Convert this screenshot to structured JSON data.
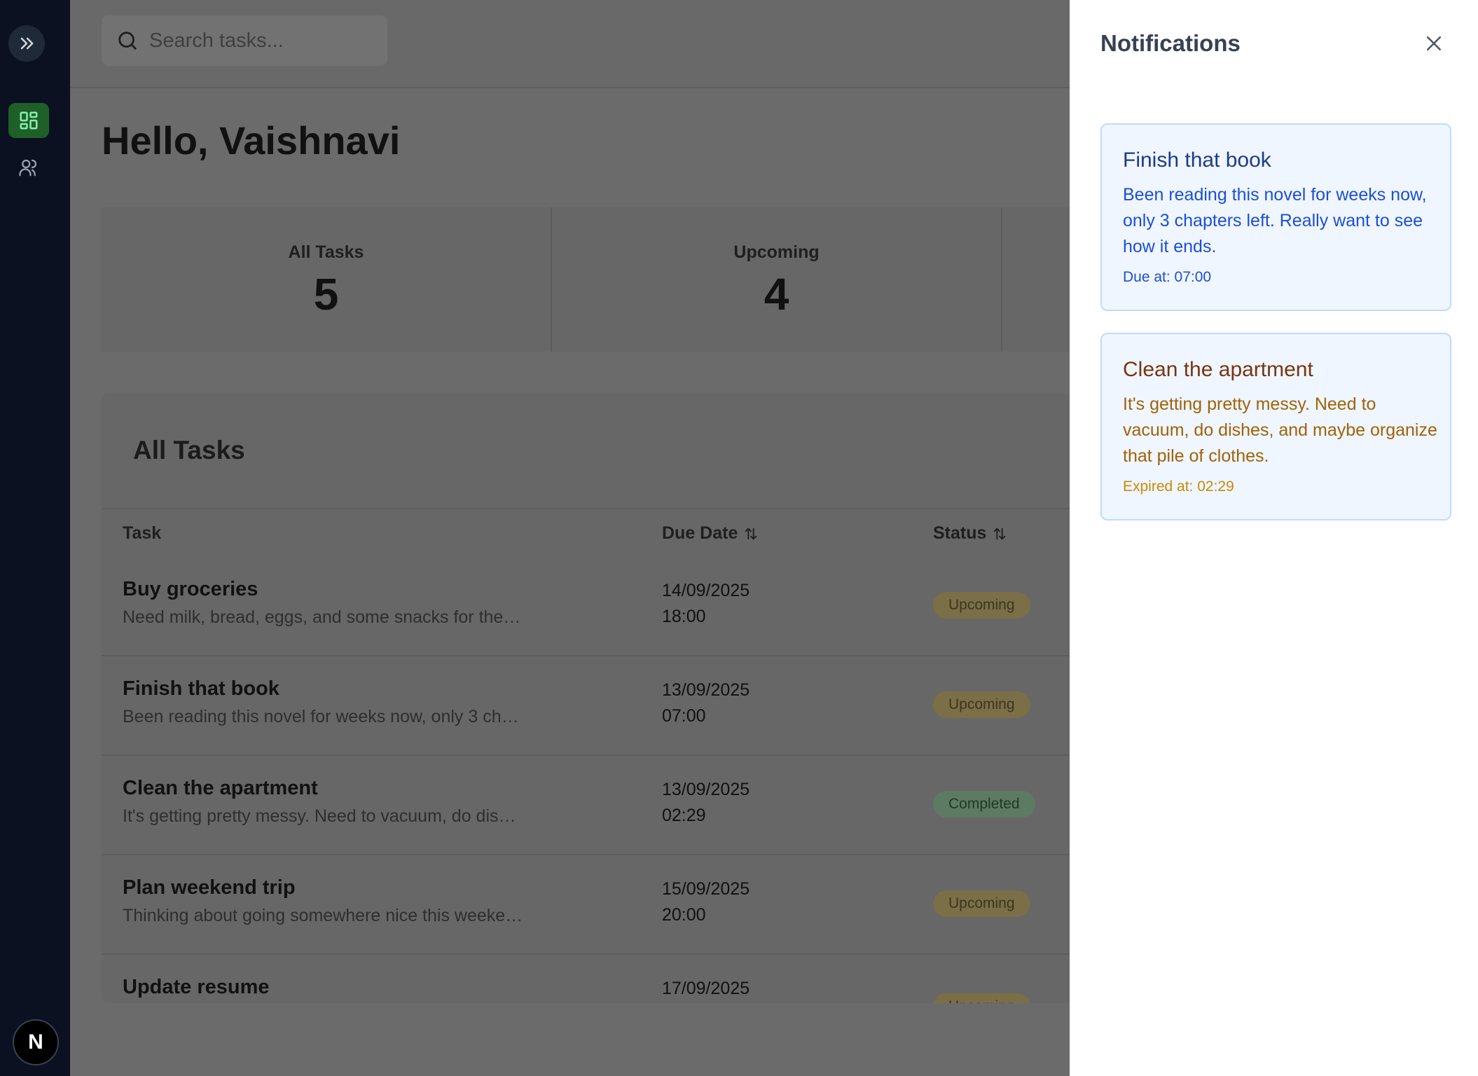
{
  "sidebar": {
    "toggle_icon": "chevrons-right-icon",
    "items": [
      {
        "name": "dashboard",
        "icon": "layout-grid-icon",
        "active": true
      },
      {
        "name": "users",
        "icon": "users-icon",
        "active": false
      }
    ],
    "avatar_initial": "N"
  },
  "search": {
    "placeholder": "Search tasks..."
  },
  "greeting": "Hello, Vaishnavi",
  "stats": [
    {
      "label": "All Tasks",
      "value": "5"
    },
    {
      "label": "Upcoming",
      "value": "4"
    }
  ],
  "tasks_panel": {
    "title": "All Tasks",
    "columns": {
      "task": "Task",
      "due": "Due Date",
      "status": "Status"
    },
    "rows": [
      {
        "title": "Buy groceries",
        "desc": "Need milk, bread, eggs, and some snacks for the…",
        "date": "14/09/2025",
        "time": "18:00",
        "status": "Upcoming"
      },
      {
        "title": "Finish that book",
        "desc": "Been reading this novel for weeks now, only 3 ch…",
        "date": "13/09/2025",
        "time": "07:00",
        "status": "Upcoming"
      },
      {
        "title": "Clean the apartment",
        "desc": "It's getting pretty messy. Need to vacuum, do dis…",
        "date": "13/09/2025",
        "time": "02:29",
        "status": "Completed"
      },
      {
        "title": "Plan weekend trip",
        "desc": "Thinking about going somewhere nice this weeke…",
        "date": "15/09/2025",
        "time": "20:00",
        "status": "Upcoming"
      },
      {
        "title": "Update resume",
        "desc": "",
        "date": "17/09/2025",
        "time": "",
        "status": "Upcoming"
      }
    ]
  },
  "notifications": {
    "title": "Notifications",
    "cards": [
      {
        "title": "Finish that book",
        "body": "Been reading this novel for weeks now, only 3 chapters left. Really want to see how it ends.",
        "footer": "Due at: 07:00",
        "tone": "blue"
      },
      {
        "title": "Clean the apartment",
        "body": "It's getting pretty messy. Need to vacuum, do dishes, and maybe organize that pile of clothes.",
        "footer": "Expired at: 02:29",
        "tone": "amber"
      }
    ]
  }
}
